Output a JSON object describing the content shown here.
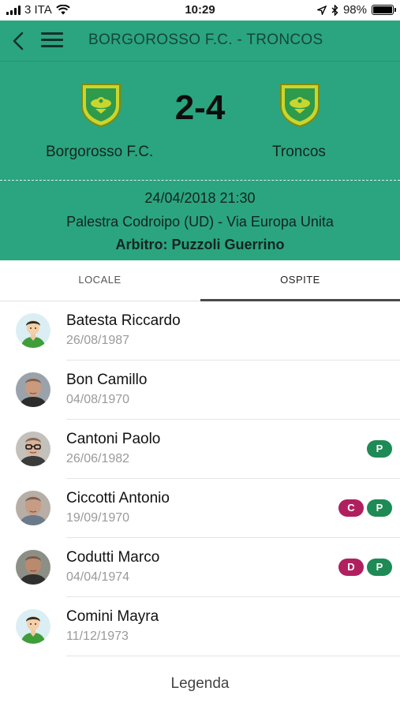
{
  "status": {
    "carrier": "3 ITA",
    "time": "10:29",
    "battery": "98%",
    "battery_level": 0.98
  },
  "header": {
    "title": "BORGOROSSO F.C. - TRONCOS"
  },
  "match": {
    "home_team": "Borgorosso F.C.",
    "away_team": "Troncos",
    "score": "2-4",
    "datetime": "24/04/2018 21:30",
    "venue": "Palestra Codroipo (UD) - Via Europa Unita",
    "referee": "Arbitro: Puzzoli Guerrino"
  },
  "tabs": {
    "local": "LOCALE",
    "guest": "OSPITE",
    "active": "guest"
  },
  "players": [
    {
      "name": "Batesta Riccardo",
      "dob": "26/08/1987",
      "avatar": "cartoon",
      "badges": []
    },
    {
      "name": "Bon Camillo",
      "dob": "04/08/1970",
      "avatar": "photo",
      "badges": []
    },
    {
      "name": "Cantoni Paolo",
      "dob": "26/06/1982",
      "avatar": "photo",
      "badges": [
        {
          "label": "P",
          "color": "#1e8a55"
        }
      ]
    },
    {
      "name": "Ciccotti Antonio",
      "dob": "19/09/1970",
      "avatar": "photo",
      "badges": [
        {
          "label": "C",
          "color": "#b0205f"
        },
        {
          "label": "P",
          "color": "#1e8a55"
        }
      ]
    },
    {
      "name": "Codutti Marco",
      "dob": "04/04/1974",
      "avatar": "photo",
      "badges": [
        {
          "label": "D",
          "color": "#b0205f"
        },
        {
          "label": "P",
          "color": "#1e8a55"
        }
      ]
    },
    {
      "name": "Comini Mayra",
      "dob": "11/12/1973",
      "avatar": "cartoon",
      "badges": []
    }
  ],
  "footer": {
    "legend": "Legenda"
  },
  "colors": {
    "accent": "#2aa57f",
    "badge_green": "#1e8a55",
    "badge_purple": "#b0205f"
  }
}
